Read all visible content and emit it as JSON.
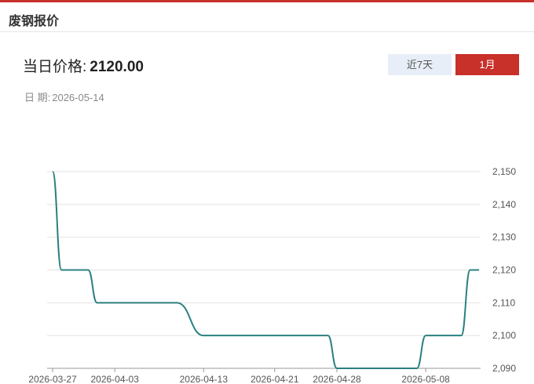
{
  "header": {
    "title": "废钢报价"
  },
  "summary": {
    "price_label": "当日价格:",
    "price_value": "2120.00",
    "date_label": "日 期:",
    "date_value": "2026-05-14"
  },
  "tabs": [
    {
      "label": "近7天",
      "active": false
    },
    {
      "label": "1月",
      "active": true
    }
  ],
  "colors": {
    "accent": "#c8302a",
    "line": "#2b8080",
    "tab_inactive_bg": "#e8eef7"
  },
  "chart_data": {
    "type": "line",
    "x": [
      "2026-03-27",
      "2026-03-28",
      "2026-03-29",
      "2026-03-30",
      "2026-03-31",
      "2026-04-01",
      "2026-04-02",
      "2026-04-03",
      "2026-04-07",
      "2026-04-08",
      "2026-04-09",
      "2026-04-10",
      "2026-04-13",
      "2026-04-14",
      "2026-04-15",
      "2026-04-16",
      "2026-04-17",
      "2026-04-20",
      "2026-04-21",
      "2026-04-22",
      "2026-04-23",
      "2026-04-24",
      "2026-04-27",
      "2026-04-28",
      "2026-04-29",
      "2026-04-30",
      "2026-05-06",
      "2026-05-07",
      "2026-05-08",
      "2026-05-11",
      "2026-05-12",
      "2026-05-13",
      "2026-05-14"
    ],
    "series": [
      {
        "values": [
          2150,
          2120,
          2120,
          2120,
          2120,
          2110,
          2110,
          2110,
          2110,
          2110,
          2110,
          2110,
          2100,
          2100,
          2100,
          2100,
          2100,
          2100,
          2100,
          2100,
          2100,
          2100,
          2100,
          2090,
          2090,
          2090,
          2090,
          2090,
          2100,
          2100,
          2100,
          2120,
          2120
        ]
      }
    ],
    "x_tick_labels": [
      "2026-03-27",
      "2026-04-03",
      "2026-04-13",
      "2026-04-21",
      "2026-04-28",
      "2026-05-08"
    ],
    "y_tick_labels": [
      "2,150",
      "2,140",
      "2,130",
      "2,120",
      "2,110",
      "2,100",
      "2,090"
    ],
    "ylim": [
      2090,
      2150
    ],
    "title": "",
    "xlabel": "",
    "ylabel": "",
    "y_axis_side": "right",
    "grid": true
  }
}
